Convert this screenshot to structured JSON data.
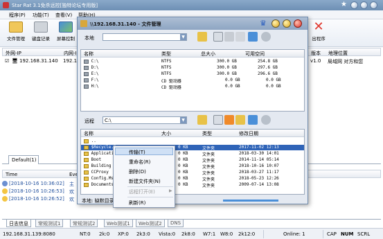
{
  "app": {
    "title": "Star Rat 3.1免杀远控[独特论坛专用版]"
  },
  "menu": [
    "程序(P)",
    "功能(T)",
    "查看(V)",
    "帮助(H)"
  ],
  "toolbar": {
    "buttons": [
      "文件管理",
      "键盘记录",
      "屏幕控制",
      "出程序"
    ]
  },
  "list": {
    "columns": [
      "外网-IP",
      "内网-I",
      "版本",
      "地理位置"
    ],
    "rows": [
      {
        "ip": "192.168.31.140",
        "lan": "192.16",
        "version": "v1.0",
        "location": "局域网 对方和您"
      }
    ]
  },
  "group_tab": "Default(1)",
  "log": {
    "columns": [
      "Time",
      "Eve"
    ],
    "rows": [
      {
        "time": "[2018-10-16 10:36:02]",
        "event": "主"
      },
      {
        "time": "[2018-10-16 10:26:53]",
        "event": "欢"
      },
      {
        "time": "[2018-10-16 10:26:52]",
        "event": "欢"
      }
    ]
  },
  "bottom_tabs": [
    "日志信息",
    "常规测试1",
    "常规测试2",
    "Web测试1",
    "Web测试2",
    "DNS"
  ],
  "status": {
    "addr": "192.168.31.139:8080",
    "nt": "NT:0",
    "k2": "2k:0",
    "xp": "XP:0",
    "k23": "2k3:0",
    "vista": "Vista:0",
    "k28": "2k8:0",
    "w7": "W7:1",
    "w8": "W8:0",
    "k12": "2k12:0",
    "online": "Online: 1",
    "cap": "CAP",
    "num": "NUM",
    "scrl": "SCRL"
  },
  "dialog": {
    "title": "\\\\192.168.31.140 - 文件管理",
    "local_label": "本地",
    "remote_label": "远程",
    "remote_path": "C:\\",
    "local_columns": [
      "名称",
      "类型",
      "总大小",
      "可用空间"
    ],
    "local_rows": [
      {
        "name": "C:\\",
        "type": "NTFS",
        "total": "300.0 GB",
        "free": "254.8 GB"
      },
      {
        "name": "D:\\",
        "type": "NTFS",
        "total": "300.0 GB",
        "free": "297.6 GB"
      },
      {
        "name": "E:\\",
        "type": "NTFS",
        "total": "300.0 GB",
        "free": "296.6 GB"
      },
      {
        "name": "F:\\",
        "type": "CD 驱动器",
        "total": "0.0 GB",
        "free": "0.0 GB"
      },
      {
        "name": "H:\\",
        "type": "CD 驱动器",
        "total": "0.0 GB",
        "free": "0.0 GB"
      }
    ],
    "remote_columns": [
      "名称",
      "大小",
      "类型",
      "修改日期"
    ],
    "remote_rows": [
      {
        "name": "..",
        "size": "",
        "type": "",
        "date": ""
      },
      {
        "name": "$Recycle.B",
        "size": "0 KB",
        "type": "文件夹",
        "date": "2017-11-02 12:13"
      },
      {
        "name": "Applicati",
        "size": "0 KB",
        "type": "文件夹",
        "date": "2018-03-30 14:01"
      },
      {
        "name": "Boot",
        "size": "0 KB",
        "type": "文件夹",
        "date": "2014-11-14 05:14"
      },
      {
        "name": "Building",
        "size": "0 KB",
        "type": "文件夹",
        "date": "2018-10-16 10:07"
      },
      {
        "name": "CCProxy",
        "size": "0 KB",
        "type": "文件夹",
        "date": "2018-03-27 11:17"
      },
      {
        "name": "Config.Ms",
        "size": "0 KB",
        "type": "文件夹",
        "date": "2018-05-23 12:26"
      },
      {
        "name": "Documents",
        "size": "0 KB",
        "type": "文件夹",
        "date": "2009-07-14 13:08"
      }
    ],
    "status": "本地: 缺默目录"
  },
  "context_menu": [
    "传输(T)",
    "重命名(R)",
    "删除(D)",
    "新建文件夹(N)",
    "远程打开(E)",
    "刷新(R)"
  ],
  "colors": {
    "title_bar": "#7a9ac0",
    "selection": "#cfe0f5",
    "link_blue": "#1f4e9c",
    "close_red": "#e0362c"
  }
}
